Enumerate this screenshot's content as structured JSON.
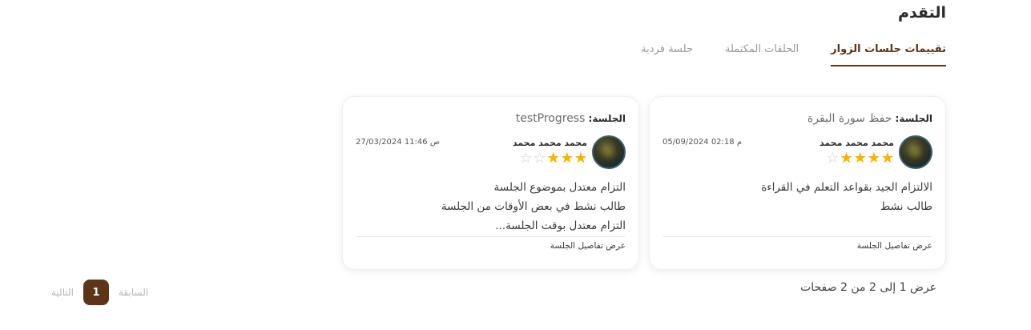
{
  "page": {
    "title": "التقدم"
  },
  "tabs": [
    {
      "label": "تقييمات جلسات الزوار",
      "active": true
    },
    {
      "label": "الحلقات المكتملة",
      "active": false
    },
    {
      "label": "جلسة فردية",
      "active": false
    }
  ],
  "cards": [
    {
      "session_label": "الجلسة:",
      "session_value": "حفظ سورة البقرة",
      "user_name": "محمد محمد محمد",
      "rating": 4,
      "rating_max": 5,
      "date": "05/09/2024 02:18 م",
      "notes": [
        "الالتزام الجيد بقواعد التعلم في القراءة",
        "طالب نشط"
      ],
      "details_link": "عرض تفاصيل الجلسة"
    },
    {
      "session_label": "الجلسة:",
      "session_value": "testProgress",
      "user_name": "محمد محمد محمد",
      "rating": 3,
      "rating_max": 5,
      "date": "27/03/2024 11:46 ص",
      "notes": [
        "التزام معتدل بموضوع الجلسة",
        "طالب نشط في بعض الأوقات من الجلسة",
        "التزام معتدل بوقت الجلسة..."
      ],
      "details_link": "عرض تفاصيل الجلسة"
    }
  ],
  "pagination": {
    "info": "عرض 1 إلى 2 من 2 صفحات",
    "prev_label": "السابقة",
    "next_label": "التالية",
    "current_page": "1"
  },
  "colors": {
    "accent": "#5c3418",
    "star_filled": "#f5b400",
    "star_empty": "#cfcfcf"
  },
  "icons": {
    "star_filled": "star-filled-icon",
    "star_empty": "star-empty-icon"
  }
}
